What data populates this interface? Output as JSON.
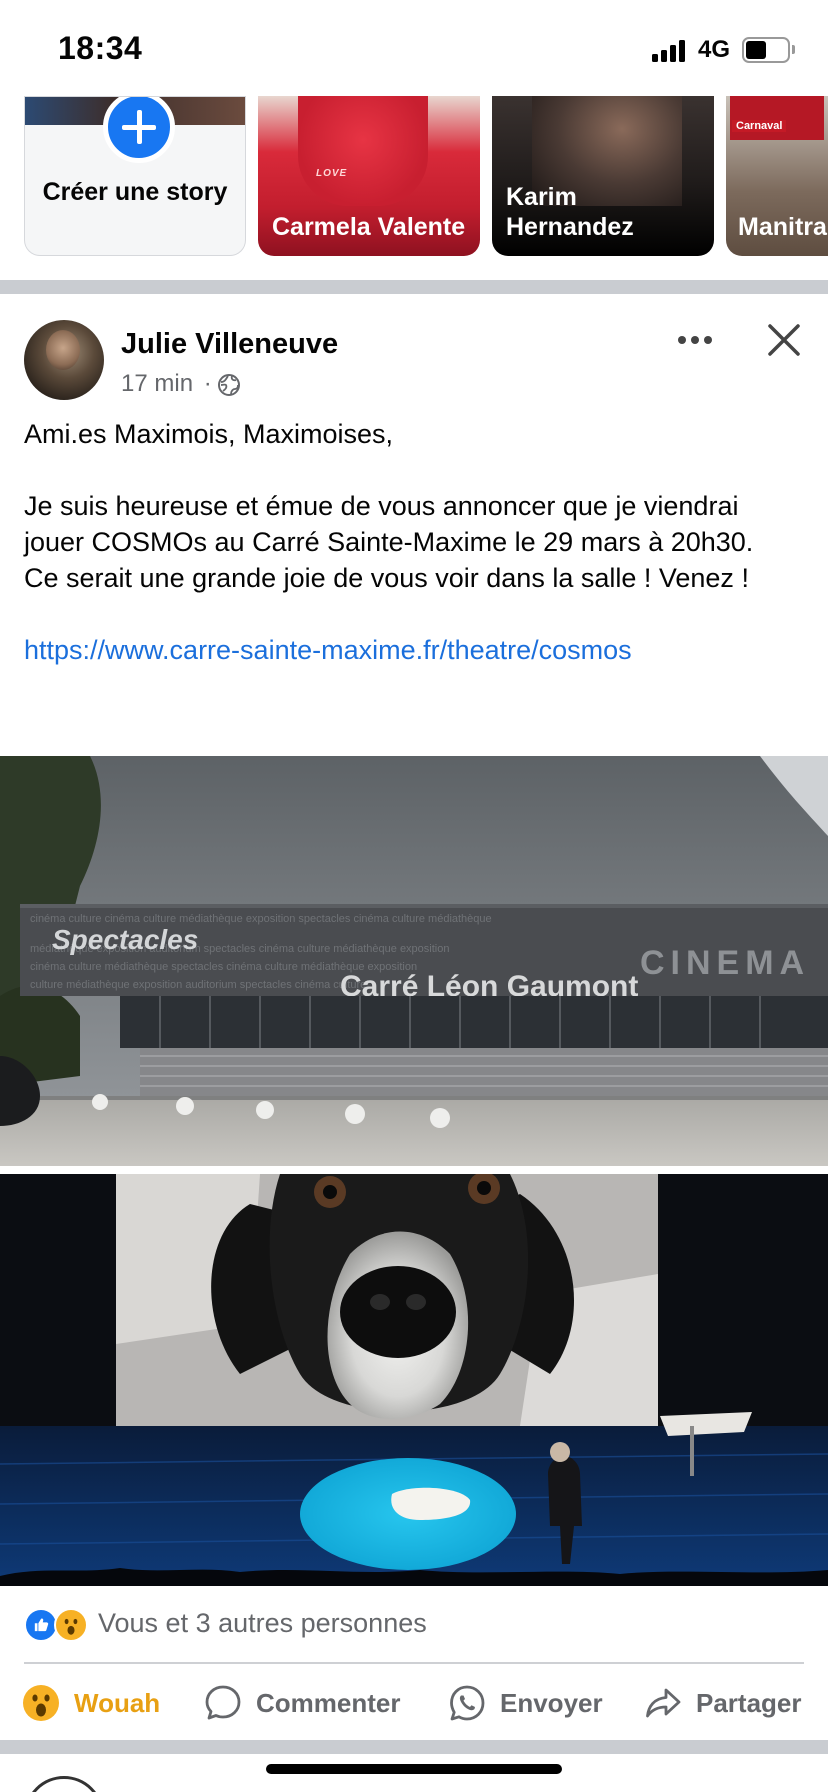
{
  "status_bar": {
    "time": "18:34",
    "network": "4G"
  },
  "stories": {
    "create_label": "Créer une story",
    "items": [
      {
        "name": "Carmela Valente",
        "overlay_text": "LOVE"
      },
      {
        "name": "Karim Hernandez"
      },
      {
        "name": "Manitra",
        "overlay_text": "Carnaval"
      }
    ]
  },
  "post": {
    "author": "Julie Villeneuve",
    "time": "17 min",
    "separator": "·",
    "audience_icon": "globe-icon",
    "paragraphs": [
      "Ami.es Maximois, Maximoises,",
      "",
      "Je suis heureuse et émue de vous annoncer que je viendrai jouer COSMOs au Carré Sainte-Maxime le 29 mars à 20h30.",
      "Ce serait une grande joie de vous voir dans la salle ! Venez !",
      ""
    ],
    "link": "https://www.carre-sainte-maxime.fr/theatre/cosmos",
    "photo_1": {
      "sign": "Carré Léon Gaumont",
      "facade_word": "Spectacles",
      "facade_side": "CINEMA"
    },
    "reactions_text": "Vous et 3 autres personnes",
    "actions": {
      "wow": "Wouah",
      "comment": "Commenter",
      "send": "Envoyer",
      "share": "Partager"
    }
  },
  "colors": {
    "accent": "#1877f2",
    "link": "#1b6fdc",
    "wow": "#e8a013",
    "muted": "#65676b"
  }
}
